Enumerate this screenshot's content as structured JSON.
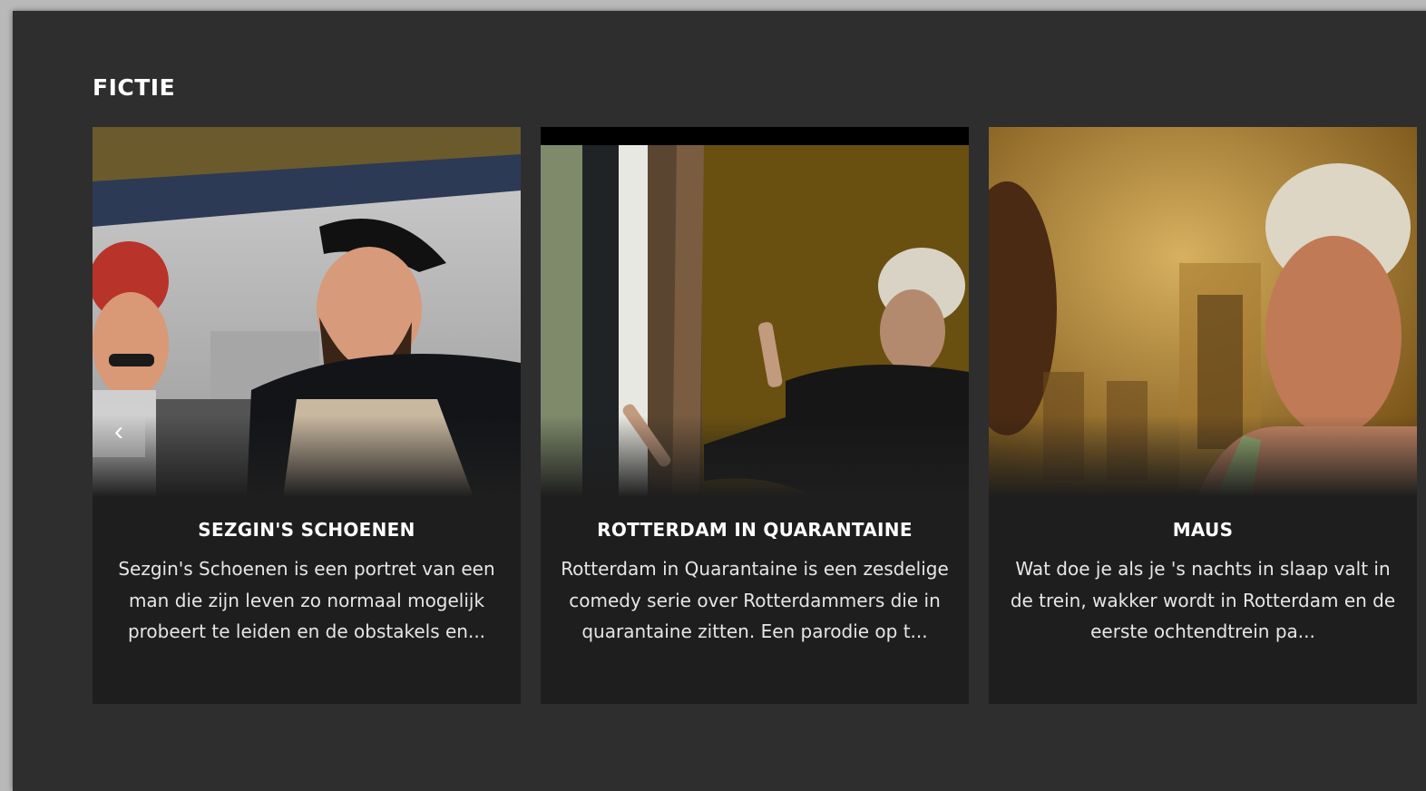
{
  "section": {
    "title": "FICTIE"
  },
  "carousel": {
    "prev_icon": "chevron-left-icon",
    "prev_glyph": "‹"
  },
  "cards": [
    {
      "title": "SEZGIN'S SCHOENEN",
      "description": "Sezgin's Schoenen is een portret van een man die zijn leven zo normaal mogelijk probeert te leiden en de obstakels en..."
    },
    {
      "title": "ROTTERDAM IN QUARANTAINE",
      "description": "Rotterdam in Quarantaine is een zesdelige comedy serie over Rotterdammers die in quarantaine zitten. Een parodie op t..."
    },
    {
      "title": "MAUS",
      "description": "Wat doe je als je 's nachts in slaap valt in de trein, wakker wordt in Rotterdam en de eerste ochtendtrein pa..."
    }
  ],
  "colors": {
    "page_bg": "#2e2e2e",
    "card_bg": "#1e1e1e",
    "text": "#ffffff"
  }
}
